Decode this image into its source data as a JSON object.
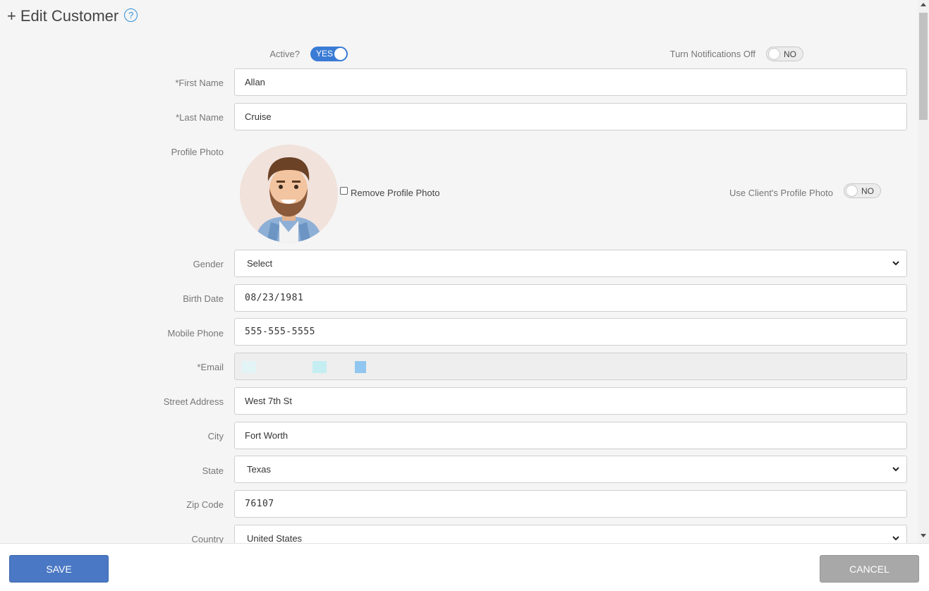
{
  "header": {
    "prefix": "+",
    "title": "Edit Customer",
    "help_glyph": "?"
  },
  "toggles": {
    "active": {
      "label": "Active?",
      "value": "YES"
    },
    "notifications": {
      "label": "Turn Notifications Off",
      "value": "NO"
    },
    "client_photo": {
      "label": "Use Client's Profile Photo",
      "value": "NO"
    }
  },
  "fields": {
    "first_name": {
      "label": "*First Name",
      "value": "Allan"
    },
    "last_name": {
      "label": "*Last Name",
      "value": "Cruise"
    },
    "profile_photo": {
      "label": "Profile Photo",
      "remove_label": "Remove Profile Photo"
    },
    "gender": {
      "label": "Gender",
      "value": "Select"
    },
    "birth_date": {
      "label": "Birth Date",
      "value": "08/23/1981"
    },
    "mobile_phone": {
      "label": "Mobile Phone",
      "value": "555-555-5555"
    },
    "email": {
      "label": "*Email",
      "value": ""
    },
    "street": {
      "label": "Street Address",
      "value": "West 7th St"
    },
    "city": {
      "label": "City",
      "value": "Fort Worth"
    },
    "state": {
      "label": "State",
      "value": "Texas"
    },
    "zip": {
      "label": "Zip Code",
      "value": "76107"
    },
    "country": {
      "label": "Country",
      "value": "United States"
    }
  },
  "footer": {
    "save_label": "SAVE",
    "cancel_label": "CANCEL"
  },
  "colors": {
    "accent": "#3a7bd5",
    "save": "#4a78c4",
    "cancel": "#a8a8a8",
    "help": "#2f8fd8"
  }
}
